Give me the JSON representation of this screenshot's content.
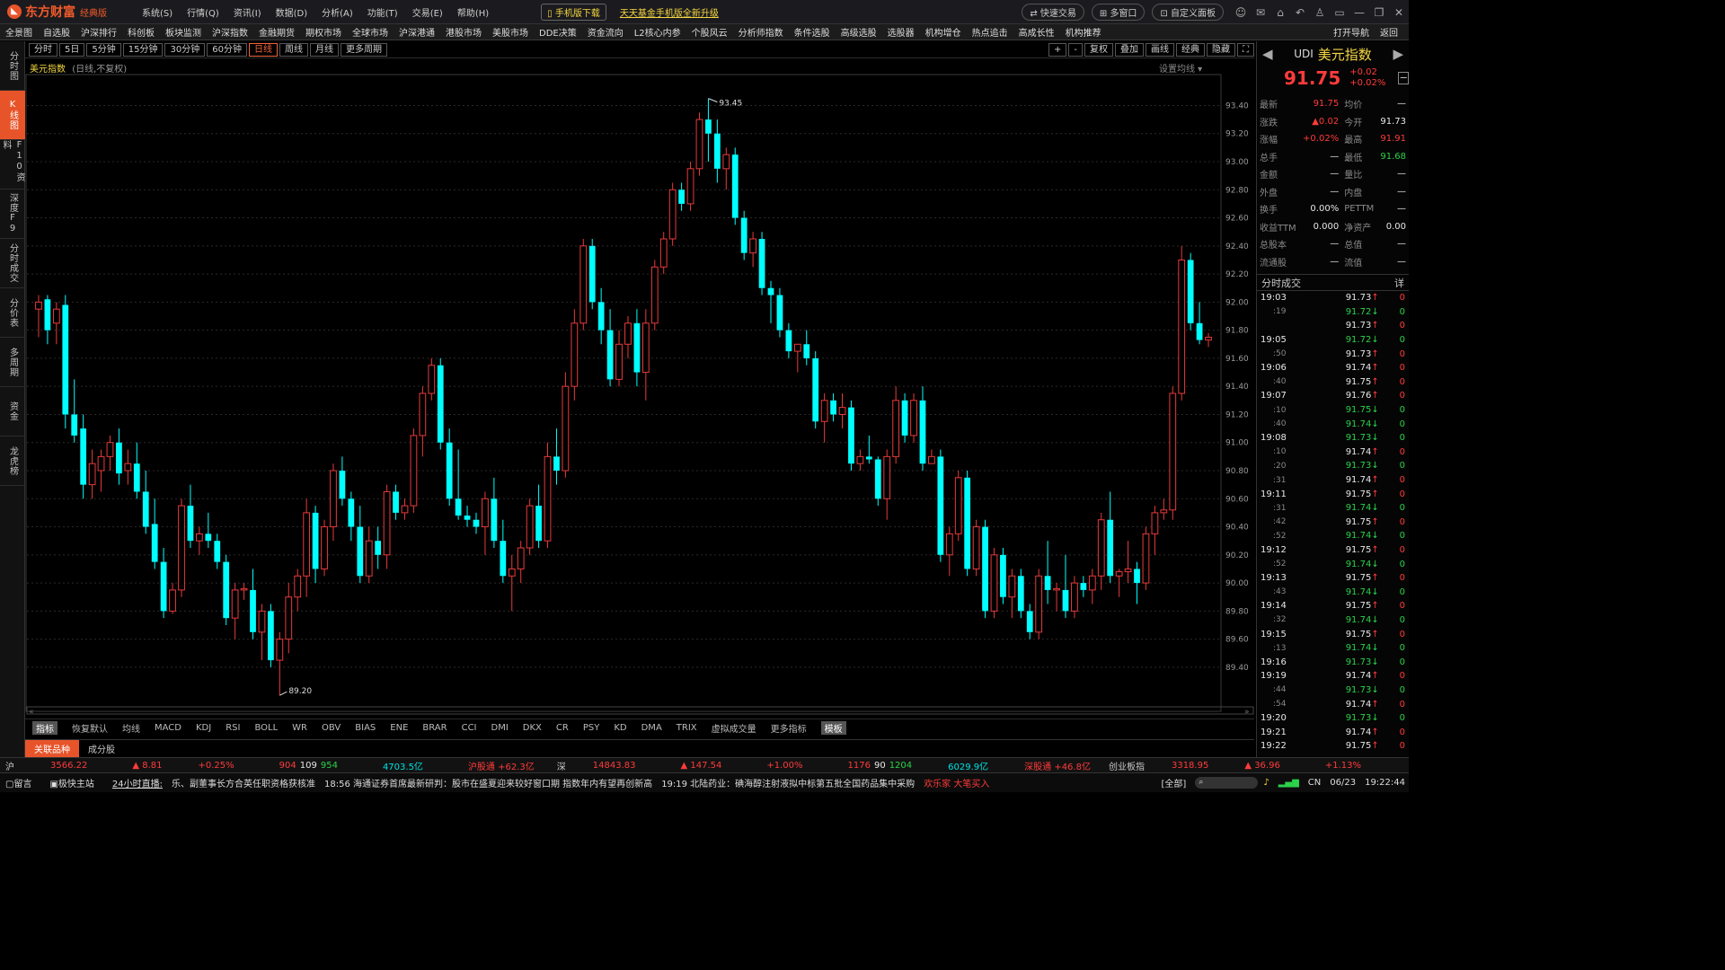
{
  "titlebar": {
    "brand": "东方财富",
    "edition": "经典版",
    "menus": [
      "系统(S)",
      "行情(Q)",
      "资讯(I)",
      "数据(D)",
      "分析(A)",
      "功能(T)",
      "交易(E)",
      "帮助(H)"
    ],
    "download": "手机版下载",
    "promo": "天天基金手机版全新升级",
    "buttons": [
      "快速交易",
      "多窗口",
      "自定义面板"
    ]
  },
  "navbar": {
    "items": [
      "全景图",
      "自选股",
      "沪深排行",
      "科创板",
      "板块监测",
      "沪深指数",
      "金融期货",
      "期权市场",
      "全球市场",
      "沪深港通",
      "港股市场",
      "美股市场",
      "DDE决策",
      "资金流向",
      "L2核心内参",
      "个股风云",
      "分析师指数",
      "条件选股",
      "高级选股",
      "选股器",
      "机构增仓",
      "热点追击",
      "高成长性",
      "机构推荐"
    ],
    "right": [
      "打开导航",
      "返回"
    ]
  },
  "periods": [
    "分时",
    "5日",
    "5分钟",
    "15分钟",
    "30分钟",
    "60分钟",
    "日线",
    "周线",
    "月线",
    "更多周期"
  ],
  "period_right": [
    "+",
    "-",
    "复权",
    "叠加",
    "画线",
    "经典",
    "隐藏"
  ],
  "left_tabs": [
    "分时图",
    "K线图",
    "F10资料",
    "深度F9",
    "分时成交",
    "分价表",
    "多周期",
    "资金",
    "龙虎榜"
  ],
  "chart": {
    "name": "美元指数",
    "subtitle": "(日线,不复权)",
    "mavg_label": "设置均线",
    "high_label": "93.45",
    "low_label": "89.20"
  },
  "chart_data": {
    "type": "candlestick",
    "title": "美元指数",
    "y_ticks": [
      89.4,
      89.6,
      89.8,
      90.0,
      90.2,
      90.4,
      90.6,
      90.8,
      91.0,
      91.2,
      91.4,
      91.6,
      91.8,
      92.0,
      92.2,
      92.4,
      92.6,
      92.8,
      93.0,
      93.2,
      93.4
    ],
    "ylim": [
      89.15,
      93.55
    ],
    "note": "OHLC estimated from chart",
    "ohlc": [
      [
        91.95,
        92.05,
        91.75,
        92.0
      ],
      [
        92.02,
        92.05,
        91.7,
        91.8
      ],
      [
        91.85,
        92.0,
        91.7,
        91.95
      ],
      [
        91.98,
        92.05,
        91.1,
        91.2
      ],
      [
        91.2,
        91.45,
        91.0,
        91.05
      ],
      [
        91.1,
        91.2,
        90.6,
        90.7
      ],
      [
        90.7,
        90.95,
        90.6,
        90.85
      ],
      [
        90.8,
        90.95,
        90.65,
        90.9
      ],
      [
        90.9,
        91.05,
        90.8,
        91.0
      ],
      [
        91.0,
        91.1,
        90.7,
        90.78
      ],
      [
        90.8,
        90.95,
        90.7,
        90.85
      ],
      [
        90.85,
        91.0,
        90.6,
        90.65
      ],
      [
        90.65,
        90.8,
        90.35,
        90.4
      ],
      [
        90.42,
        90.6,
        90.1,
        90.15
      ],
      [
        90.15,
        90.25,
        89.75,
        89.8
      ],
      [
        89.8,
        90.0,
        89.78,
        89.95
      ],
      [
        89.95,
        90.6,
        89.9,
        90.55
      ],
      [
        90.55,
        90.7,
        90.25,
        90.3
      ],
      [
        90.3,
        90.4,
        90.2,
        90.35
      ],
      [
        90.35,
        90.5,
        90.25,
        90.3
      ],
      [
        90.3,
        90.35,
        90.1,
        90.15
      ],
      [
        90.15,
        90.2,
        89.7,
        89.75
      ],
      [
        89.75,
        90.0,
        89.6,
        89.95
      ],
      [
        89.95,
        90.0,
        89.88,
        89.96
      ],
      [
        89.95,
        90.1,
        89.6,
        89.65
      ],
      [
        89.65,
        89.85,
        89.45,
        89.8
      ],
      [
        89.8,
        89.85,
        89.4,
        89.45
      ],
      [
        89.45,
        89.65,
        89.2,
        89.6
      ],
      [
        89.6,
        90.0,
        89.5,
        89.9
      ],
      [
        89.9,
        90.1,
        89.8,
        90.05
      ],
      [
        90.05,
        90.6,
        89.9,
        90.5
      ],
      [
        90.5,
        90.55,
        90.0,
        90.1
      ],
      [
        90.1,
        90.45,
        90.05,
        90.4
      ],
      [
        90.4,
        90.85,
        90.3,
        90.8
      ],
      [
        90.8,
        90.9,
        90.55,
        90.6
      ],
      [
        90.6,
        90.65,
        90.3,
        90.4
      ],
      [
        90.4,
        90.55,
        90.0,
        90.05
      ],
      [
        90.05,
        90.4,
        90.0,
        90.3
      ],
      [
        90.3,
        90.4,
        90.1,
        90.2
      ],
      [
        90.2,
        90.7,
        90.1,
        90.65
      ],
      [
        90.65,
        90.7,
        90.45,
        90.5
      ],
      [
        90.5,
        90.6,
        90.45,
        90.55
      ],
      [
        90.55,
        91.1,
        90.5,
        91.05
      ],
      [
        91.05,
        91.4,
        90.9,
        91.35
      ],
      [
        91.35,
        91.6,
        91.3,
        91.55
      ],
      [
        91.55,
        91.6,
        90.95,
        91.0
      ],
      [
        91.0,
        91.1,
        90.55,
        90.6
      ],
      [
        90.6,
        90.95,
        90.45,
        90.48
      ],
      [
        90.48,
        90.55,
        90.4,
        90.45
      ],
      [
        90.45,
        90.5,
        90.35,
        90.4
      ],
      [
        90.4,
        90.65,
        90.2,
        90.6
      ],
      [
        90.6,
        90.75,
        90.25,
        90.3
      ],
      [
        90.3,
        90.45,
        90.0,
        90.05
      ],
      [
        90.05,
        90.2,
        89.8,
        90.1
      ],
      [
        90.1,
        90.3,
        90.0,
        90.25
      ],
      [
        90.25,
        90.6,
        90.2,
        90.55
      ],
      [
        90.55,
        90.7,
        90.25,
        90.3
      ],
      [
        90.3,
        91.0,
        90.25,
        90.9
      ],
      [
        90.9,
        91.1,
        90.7,
        90.8
      ],
      [
        90.8,
        91.5,
        90.75,
        91.4
      ],
      [
        91.4,
        91.95,
        91.3,
        91.85
      ],
      [
        91.85,
        92.45,
        91.8,
        92.4
      ],
      [
        92.4,
        92.45,
        91.95,
        92.0
      ],
      [
        92.0,
        92.1,
        91.7,
        91.8
      ],
      [
        91.8,
        91.95,
        91.4,
        91.45
      ],
      [
        91.45,
        91.8,
        91.4,
        91.7
      ],
      [
        91.7,
        91.9,
        91.6,
        91.85
      ],
      [
        91.85,
        91.95,
        91.4,
        91.5
      ],
      [
        91.5,
        91.95,
        91.3,
        91.85
      ],
      [
        91.85,
        92.3,
        91.8,
        92.25
      ],
      [
        92.25,
        92.5,
        92.2,
        92.45
      ],
      [
        92.45,
        92.85,
        92.4,
        92.8
      ],
      [
        92.8,
        92.85,
        92.65,
        92.7
      ],
      [
        92.7,
        93.0,
        92.65,
        92.95
      ],
      [
        92.95,
        93.35,
        92.9,
        93.3
      ],
      [
        93.3,
        93.45,
        93.0,
        93.2
      ],
      [
        93.2,
        93.3,
        92.85,
        92.95
      ],
      [
        92.95,
        93.1,
        92.8,
        93.05
      ],
      [
        93.05,
        93.1,
        92.55,
        92.6
      ],
      [
        92.6,
        92.65,
        92.3,
        92.35
      ],
      [
        92.35,
        92.5,
        92.25,
        92.45
      ],
      [
        92.45,
        92.5,
        92.05,
        92.1
      ],
      [
        92.1,
        92.15,
        91.85,
        92.05
      ],
      [
        92.05,
        92.1,
        91.75,
        91.8
      ],
      [
        91.8,
        91.85,
        91.6,
        91.65
      ],
      [
        91.65,
        91.7,
        91.5,
        91.7
      ],
      [
        91.7,
        91.8,
        91.55,
        91.6
      ],
      [
        91.6,
        91.65,
        91.1,
        91.15
      ],
      [
        91.15,
        91.35,
        91.0,
        91.3
      ],
      [
        91.3,
        91.35,
        91.15,
        91.2
      ],
      [
        91.2,
        91.35,
        91.1,
        91.25
      ],
      [
        91.25,
        91.3,
        90.8,
        90.85
      ],
      [
        90.85,
        90.95,
        90.8,
        90.9
      ],
      [
        90.9,
        91.05,
        90.85,
        90.88
      ],
      [
        90.88,
        90.9,
        90.55,
        90.6
      ],
      [
        90.6,
        90.95,
        90.45,
        90.9
      ],
      [
        90.9,
        91.4,
        90.85,
        91.3
      ],
      [
        91.3,
        91.35,
        91.0,
        91.05
      ],
      [
        91.05,
        91.35,
        91.0,
        91.3
      ],
      [
        91.3,
        91.4,
        90.8,
        90.85
      ],
      [
        90.85,
        90.95,
        90.85,
        90.9
      ],
      [
        90.9,
        90.95,
        90.15,
        90.2
      ],
      [
        90.2,
        90.4,
        90.05,
        90.35
      ],
      [
        90.35,
        90.8,
        90.3,
        90.75
      ],
      [
        90.75,
        90.8,
        90.05,
        90.1
      ],
      [
        90.1,
        90.45,
        90.05,
        90.4
      ],
      [
        90.4,
        90.45,
        89.75,
        89.8
      ],
      [
        89.8,
        90.25,
        89.75,
        90.2
      ],
      [
        90.2,
        90.25,
        89.85,
        89.9
      ],
      [
        89.9,
        90.1,
        89.75,
        90.05
      ],
      [
        90.05,
        90.1,
        89.75,
        89.8
      ],
      [
        89.8,
        89.85,
        89.6,
        89.65
      ],
      [
        89.65,
        90.1,
        89.6,
        90.05
      ],
      [
        90.05,
        90.3,
        89.85,
        89.95
      ],
      [
        89.95,
        90.0,
        89.8,
        89.96
      ],
      [
        89.95,
        90.2,
        89.75,
        89.8
      ],
      [
        89.8,
        90.05,
        89.75,
        90.0
      ],
      [
        90.0,
        90.05,
        89.9,
        89.95
      ],
      [
        89.95,
        90.1,
        89.85,
        90.05
      ],
      [
        90.05,
        90.5,
        89.95,
        90.45
      ],
      [
        90.45,
        90.65,
        90.0,
        90.05
      ],
      [
        90.05,
        90.1,
        89.9,
        90.08
      ],
      [
        90.08,
        90.3,
        90.0,
        90.1
      ],
      [
        90.1,
        90.15,
        89.85,
        90.0
      ],
      [
        90.0,
        90.4,
        89.95,
        90.35
      ],
      [
        90.35,
        90.55,
        90.2,
        90.5
      ],
      [
        90.5,
        90.6,
        90.45,
        90.52
      ],
      [
        90.52,
        91.4,
        90.45,
        91.35
      ],
      [
        91.35,
        92.4,
        91.3,
        92.3
      ],
      [
        92.3,
        92.35,
        91.8,
        91.85
      ],
      [
        91.85,
        92.0,
        91.7,
        91.73
      ],
      [
        91.73,
        91.78,
        91.68,
        91.75
      ]
    ]
  },
  "bottom_tabs": [
    "指标",
    "恢复默认",
    "均线",
    "MACD",
    "KDJ",
    "RSI",
    "BOLL",
    "WR",
    "OBV",
    "BIAS",
    "ENE",
    "BRAR",
    "CCI",
    "DMI",
    "DKX",
    "CR",
    "PSY",
    "KD",
    "DMA",
    "TRIX",
    "虚拟成交量",
    "更多指标",
    "模板"
  ],
  "related_tabs": [
    "关联品种",
    "成分股"
  ],
  "quote": {
    "code": "UDI",
    "name": "美元指数",
    "price": "91.75",
    "change": "+0.02",
    "change_pct": "+0.02%",
    "rows": [
      [
        "最新",
        "91.75",
        "均价",
        "—"
      ],
      [
        "涨跌",
        "▲0.02",
        "今开",
        "91.73"
      ],
      [
        "涨幅",
        "+0.02%",
        "最高",
        "91.91"
      ],
      [
        "总手",
        "—",
        "最低",
        "91.68"
      ],
      [
        "金额",
        "—",
        "量比",
        "—"
      ],
      [
        "外盘",
        "—",
        "内盘",
        "—"
      ],
      [
        "换手",
        "0.00%",
        "PETTM",
        "—"
      ],
      [
        "收益TTM",
        "0.000",
        "净资产",
        "0.00"
      ],
      [
        "总股本",
        "—",
        "总值",
        "—"
      ],
      [
        "流通股",
        "—",
        "流值",
        "—"
      ]
    ]
  },
  "ticks": {
    "title": "分时成交",
    "detail": "详",
    "rows": [
      [
        "19:03",
        "91.73",
        "↑",
        "0"
      ],
      [
        ":19",
        "91.72",
        "↓",
        "0"
      ],
      [
        "",
        "91.73",
        "↑",
        "0"
      ],
      [
        "19:05",
        "91.72",
        "↓",
        "0"
      ],
      [
        ":50",
        "91.73",
        "↑",
        "0"
      ],
      [
        "19:06",
        "91.74",
        "↑",
        "0"
      ],
      [
        ":40",
        "91.75",
        "↑",
        "0"
      ],
      [
        "19:07",
        "91.76",
        "↑",
        "0"
      ],
      [
        ":10",
        "91.75",
        "↓",
        "0"
      ],
      [
        ":40",
        "91.74",
        "↓",
        "0"
      ],
      [
        "19:08",
        "91.73",
        "↓",
        "0"
      ],
      [
        ":10",
        "91.74",
        "↑",
        "0"
      ],
      [
        ":20",
        "91.73",
        "↓",
        "0"
      ],
      [
        ":31",
        "91.74",
        "↑",
        "0"
      ],
      [
        "19:11",
        "91.75",
        "↑",
        "0"
      ],
      [
        ":31",
        "91.74",
        "↓",
        "0"
      ],
      [
        ":42",
        "91.75",
        "↑",
        "0"
      ],
      [
        ":52",
        "91.74",
        "↓",
        "0"
      ],
      [
        "19:12",
        "91.75",
        "↑",
        "0"
      ],
      [
        ":52",
        "91.74",
        "↓",
        "0"
      ],
      [
        "19:13",
        "91.75",
        "↑",
        "0"
      ],
      [
        ":43",
        "91.74",
        "↓",
        "0"
      ],
      [
        "19:14",
        "91.75",
        "↑",
        "0"
      ],
      [
        ":32",
        "91.74",
        "↓",
        "0"
      ],
      [
        "19:15",
        "91.75",
        "↑",
        "0"
      ],
      [
        ":13",
        "91.74",
        "↓",
        "0"
      ],
      [
        "19:16",
        "91.73",
        "↓",
        "0"
      ],
      [
        "19:19",
        "91.74",
        "↑",
        "0"
      ],
      [
        ":44",
        "91.73",
        "↓",
        "0"
      ],
      [
        ":54",
        "91.74",
        "↑",
        "0"
      ],
      [
        "19:20",
        "91.73",
        "↓",
        "0"
      ],
      [
        "19:21",
        "91.74",
        "↑",
        "0"
      ],
      [
        "19:22",
        "91.75",
        "↑",
        "0"
      ]
    ]
  },
  "status": {
    "sh": "沪",
    "sh_index": "3566.22",
    "sh_chg": "▲ 8.81",
    "sh_pct": "+0.25%",
    "sh_a": "904",
    "sh_b": "109",
    "sh_c": "954",
    "sh_amt": "4703.5亿",
    "hgt": "沪股通 +62.3亿",
    "sz": "深",
    "sz_index": "14843.83",
    "sz_chg": "▲ 147.54",
    "sz_pct": "+1.00%",
    "sz_a": "1176",
    "sz_b": "90",
    "sz_c": "1204",
    "sz_amt": "6029.9亿",
    "sgt": "深股通 +46.8亿",
    "cyb": "创业板指",
    "cyb_index": "3318.95",
    "cyb_chg": "▲ 36.96",
    "cyb_pct": "+1.13%"
  },
  "news": {
    "a": "留言",
    "b": "极快主站",
    "c": "24小时直播:",
    "items": [
      "乐、副董事长方合英任职资格获核准",
      "18:56  海通证券首席最新研判：股市在盛夏迎来较好窗口期 指数年内有望再创新高",
      "19:19  北陆药业：碘海醇注射液拟中标第五批全国药品集中采购"
    ],
    "promo": "欢乐家 大笔买入",
    "all": "[全部]",
    "date": "06/23",
    "time": "19:22:44",
    "lang": "CN"
  }
}
